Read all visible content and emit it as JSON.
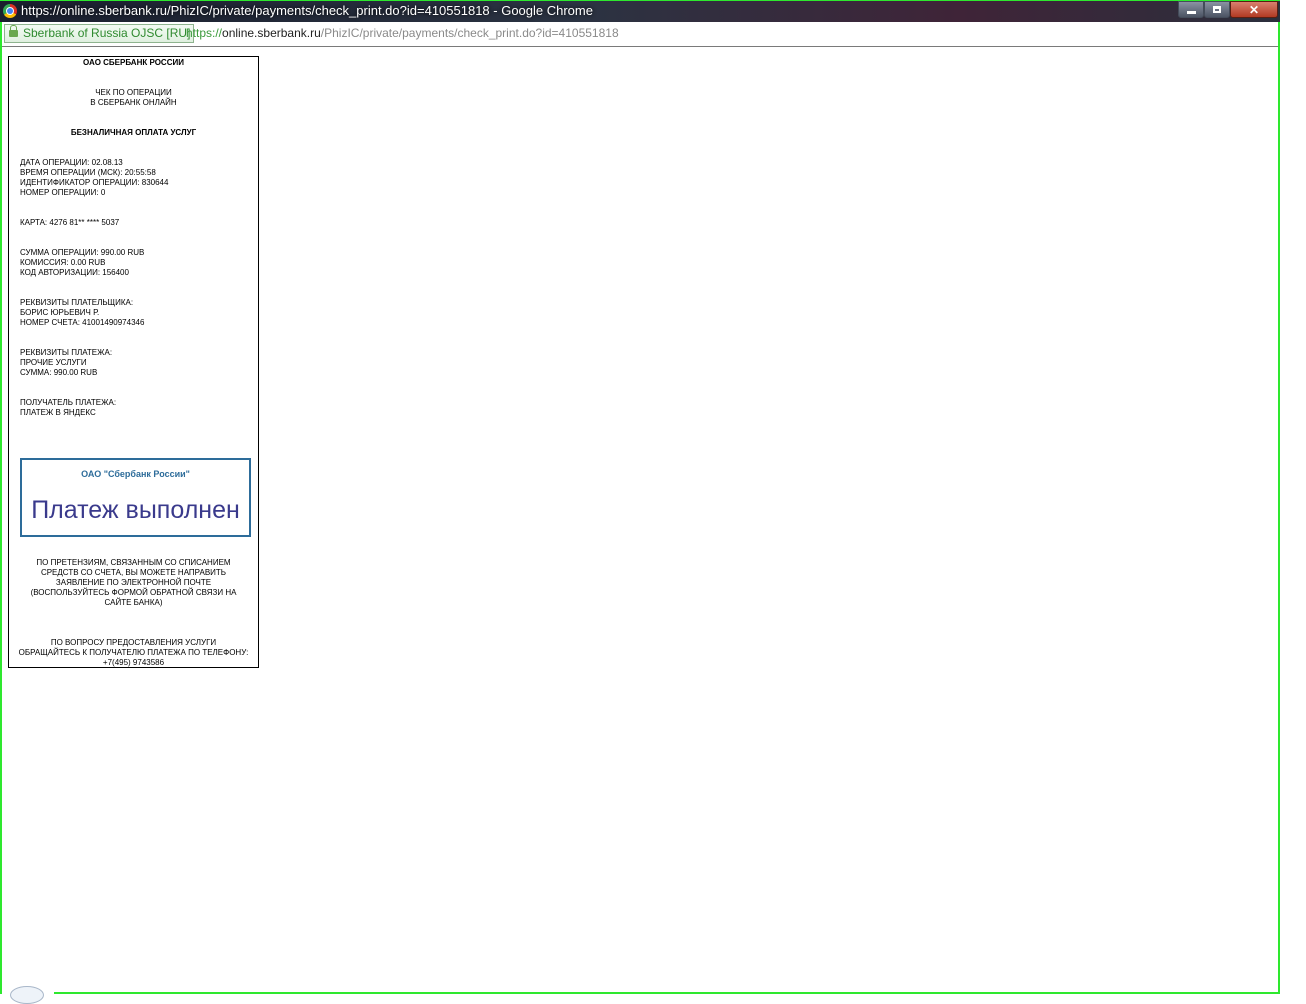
{
  "window": {
    "title": "https://online.sberbank.ru/PhizIC/private/payments/check_print.do?id=410551818 - Google Chrome",
    "buttons": {
      "minimize": "",
      "maximize": "",
      "close": "✕"
    }
  },
  "address_bar": {
    "ev_badge": "Sberbank of Russia OJSC [RU]",
    "url_scheme": "https://",
    "url_host": "online.sberbank.ru",
    "url_path": "/PhizIC/private/payments/check_print.do?id=410551818"
  },
  "receipt": {
    "bank_name": "ОАО СБЕРБАНК РОССИИ",
    "check_title_1": "ЧЕК ПО ОПЕРАЦИИ",
    "check_title_2": "В СБЕРБАНК ОНЛАЙН",
    "payment_type": "БЕЗНАЛИЧНАЯ ОПЛАТА УСЛУГ",
    "operation_date": "ДАТА ОПЕРАЦИИ: 02.08.13",
    "operation_time": "ВРЕМЯ ОПЕРАЦИИ (МСК): 20:55:58",
    "operation_id": "ИДЕНТИФИКАТОР ОПЕРАЦИИ: 830644",
    "operation_number": "НОМЕР ОПЕРАЦИИ: 0",
    "card": "КАРТА: 4276 81** **** 5037",
    "amount": "СУММА ОПЕРАЦИИ: 990.00  RUB",
    "commission": "КОМИССИЯ: 0.00 RUB",
    "auth_code": "КОД АВТОРИЗАЦИИ: 156400",
    "payer_header": "РЕКВИЗИТЫ ПЛАТЕЛЬЩИКА:",
    "payer_name": "БОРИС ЮРЬЕВИЧ Р.",
    "payer_account": "НОМЕР СЧЕТА:  41001490974346",
    "payment_header": "РЕКВИЗИТЫ ПЛАТЕЖА:",
    "payment_service": "ПРОЧИЕ УСЛУГИ",
    "payment_sum": "СУММА:  990.00 RUB",
    "recipient_header": "ПОЛУЧАТЕЛЬ ПЛАТЕЖА:",
    "recipient_name": "ПЛАТЕЖ В ЯНДЕКС",
    "stamp_bank": "ОАО \"Сбербанк России\"",
    "stamp_status": "Платеж выполнен",
    "claims_lines": [
      "ПО ПРЕТЕНЗИЯМ, СВЯЗАННЫМ СО СПИСАНИЕМ",
      "СРЕДСТВ СО СЧЕТА, ВЫ МОЖЕТЕ НАПРАВИТЬ",
      "ЗАЯВЛЕНИЕ ПО ЭЛЕКТРОННОЙ ПОЧТЕ",
      "(ВОСПОЛЬЗУЙТЕСЬ ФОРМОЙ ОБРАТНОЙ СВЯЗИ НА",
      "САЙТЕ БАНКА)"
    ],
    "service_lines": [
      "ПО ВОПРОСУ ПРЕДОСТАВЛЕНИЯ УСЛУГИ",
      "ОБРАЩАЙТЕСЬ К ПОЛУЧАТЕЛЮ ПЛАТЕЖА ПО ТЕЛЕФОНУ:",
      "+7(495) 9743586"
    ]
  },
  "colors": {
    "window_frame": "#2ee82e",
    "stamp_border": "#2d6c9a",
    "stamp_text": "#3a3a8c"
  }
}
